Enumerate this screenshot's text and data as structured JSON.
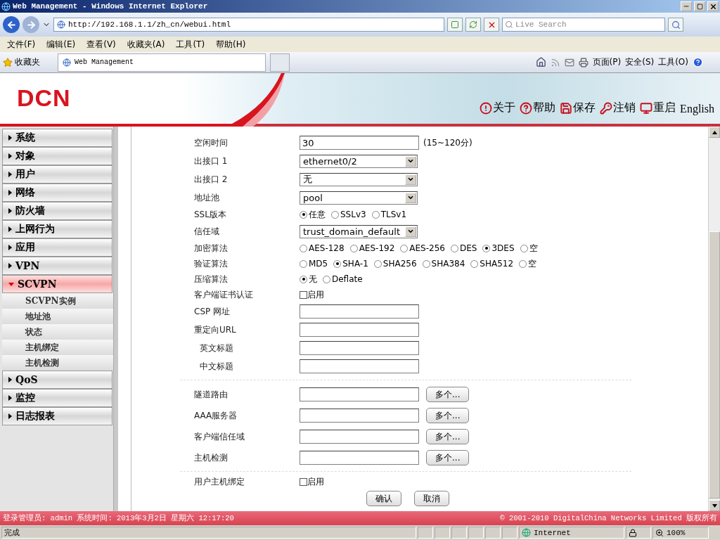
{
  "browser": {
    "title": "Web Management - Windows Internet Explorer",
    "address": "http://192.168.1.1/zh_cn/webui.html",
    "search_placeholder": "Live Search",
    "menu": [
      "文件(F)",
      "编辑(E)",
      "查看(V)",
      "收藏夹(A)",
      "工具(T)",
      "帮助(H)"
    ],
    "favorites": "收藏夹",
    "tab_title": "Web Management",
    "commands": [
      "页面(P)",
      "安全(S)",
      "工具(O)"
    ]
  },
  "header": {
    "logo": "DCN",
    "actions": [
      {
        "kind": "about",
        "label": "关于"
      },
      {
        "kind": "help",
        "label": "帮助"
      },
      {
        "kind": "save",
        "label": "保存"
      },
      {
        "kind": "logout",
        "label": "注销"
      },
      {
        "kind": "restart",
        "label": "重启"
      }
    ],
    "language": "English"
  },
  "sidebar": {
    "items": [
      {
        "label": "系统",
        "expanded": false
      },
      {
        "label": "对象",
        "expanded": false
      },
      {
        "label": "用户",
        "expanded": false
      },
      {
        "label": "网络",
        "expanded": false
      },
      {
        "label": "防火墙",
        "expanded": false
      },
      {
        "label": "上网行为",
        "expanded": false
      },
      {
        "label": "应用",
        "expanded": false
      },
      {
        "label": "VPN",
        "expanded": false
      },
      {
        "label": "SCVPN",
        "expanded": true,
        "children": [
          {
            "label": "SCVPN实例"
          },
          {
            "label": "地址池"
          },
          {
            "label": "状态"
          },
          {
            "label": "主机绑定"
          },
          {
            "label": "主机检测"
          }
        ]
      },
      {
        "label": "QoS",
        "expanded": false
      },
      {
        "label": "监控",
        "expanded": false
      },
      {
        "label": "日志报表",
        "expanded": false
      }
    ]
  },
  "form": {
    "rows": [
      {
        "kind": "text",
        "label": "空闲时间",
        "value": "30",
        "hint": "(15~120分)"
      },
      {
        "kind": "select",
        "label": "出接口 1",
        "value": "ethernet0/2"
      },
      {
        "kind": "select",
        "label": "出接口 2",
        "value": "无"
      },
      {
        "kind": "select",
        "label": "地址池",
        "value": "pool"
      },
      {
        "kind": "radio",
        "label": "SSL版本",
        "options": [
          {
            "label": "任意",
            "selected": true
          },
          {
            "label": "SSLv3",
            "selected": false
          },
          {
            "label": "TLSv1",
            "selected": false
          }
        ]
      },
      {
        "kind": "select",
        "label": "信任域",
        "value": "trust_domain_default"
      },
      {
        "kind": "radio",
        "label": "加密算法",
        "options": [
          {
            "label": "AES-128",
            "selected": false
          },
          {
            "label": "AES-192",
            "selected": false
          },
          {
            "label": "AES-256",
            "selected": false
          },
          {
            "label": "DES",
            "selected": false
          },
          {
            "label": "3DES",
            "selected": true
          },
          {
            "label": "空",
            "selected": false
          }
        ]
      },
      {
        "kind": "radio",
        "label": "验证算法",
        "options": [
          {
            "label": "MD5",
            "selected": false
          },
          {
            "label": "SHA-1",
            "selected": true
          },
          {
            "label": "SHA256",
            "selected": false
          },
          {
            "label": "SHA384",
            "selected": false
          },
          {
            "label": "SHA512",
            "selected": false
          },
          {
            "label": "空",
            "selected": false
          }
        ]
      },
      {
        "kind": "radio",
        "label": "压缩算法",
        "options": [
          {
            "label": "无",
            "selected": true
          },
          {
            "label": "Deflate",
            "selected": false
          }
        ]
      },
      {
        "kind": "checkbox",
        "label": "客户端证书认证",
        "option": "启用",
        "checked": false
      },
      {
        "kind": "text",
        "label": "CSP 网址"
      },
      {
        "kind": "text",
        "label": "重定向URL",
        "children": [
          {
            "kind": "text",
            "label": "英文标题"
          },
          {
            "kind": "text",
            "label": "中文标题"
          }
        ]
      },
      {
        "kind": "divider"
      },
      {
        "kind": "multi",
        "label": "隧道路由",
        "button": "多个..."
      },
      {
        "kind": "multi",
        "label": "AAA服务器",
        "button": "多个..."
      },
      {
        "kind": "multi",
        "label": "客户端信任域",
        "button": "多个..."
      },
      {
        "kind": "multi",
        "label": "主机检测",
        "button": "多个..."
      },
      {
        "kind": "divider"
      },
      {
        "kind": "checkbox",
        "label": "用户主机绑定",
        "option": "启用",
        "checked": false
      }
    ],
    "buttons": [
      "确认",
      "取消"
    ]
  },
  "footer": {
    "left": "登录管理员: admin 系统时间: 2013年3月2日 星期六 12:17:20",
    "right": "© 2001-2010 DigitalChina Networks Limited 版权所有"
  },
  "status_bar": {
    "text": "完成",
    "zone": "Internet",
    "zoom": "100%"
  }
}
